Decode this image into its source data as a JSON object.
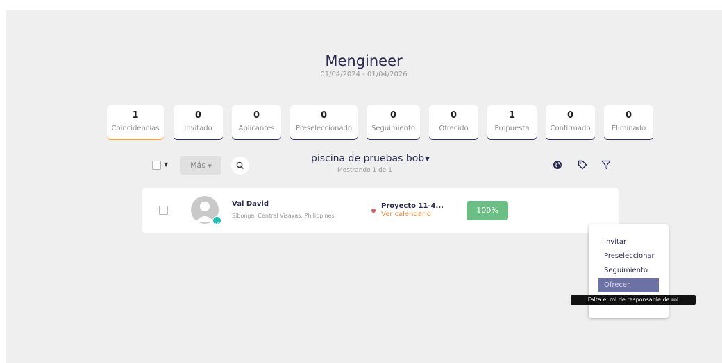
{
  "header": {
    "title": "Mengineer",
    "dates": "01/04/2024 - 01/04/2026"
  },
  "stages": [
    {
      "count": "1",
      "label": "Coincidencias"
    },
    {
      "count": "0",
      "label": "Invitado"
    },
    {
      "count": "0",
      "label": "Aplicantes"
    },
    {
      "count": "0",
      "label": "Preseleccionado"
    },
    {
      "count": "0",
      "label": "Seguimiento"
    },
    {
      "count": "0",
      "label": "Ofrecido"
    },
    {
      "count": "1",
      "label": "Propuesta"
    },
    {
      "count": "0",
      "label": "Confirmado"
    },
    {
      "count": "0",
      "label": "Eliminado"
    }
  ],
  "toolbar": {
    "more_label": "Más",
    "pool_name": "piscina de pruebas bob",
    "showing": "Mostrando 1 de 1",
    "icons": [
      "globe-icon",
      "tag-icon",
      "filter-icon",
      "search-icon"
    ]
  },
  "candidate": {
    "name": "Val David",
    "location": "Sibonga, Central Visayas, Philippines",
    "project": "Proyecto 11-4...",
    "calendar_link": "Ver calendario",
    "match": "100%"
  },
  "menu": {
    "items": [
      "Invitar",
      "Preseleccionar",
      "Seguimiento",
      "Ofrecer"
    ],
    "tooltip": "Falta el rol de responsable de rol"
  },
  "colors": {
    "active_tab": "#f0a44a",
    "match_badge": "#6cbf84",
    "calendar_link": "#ee8a3a",
    "menu_highlight": "#6c71a6",
    "verified_badge": "#1fbfb1"
  }
}
